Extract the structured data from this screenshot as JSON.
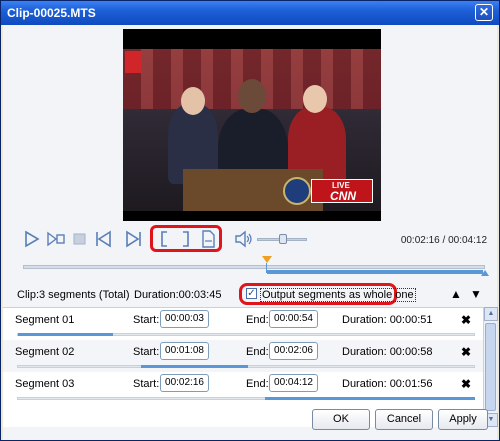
{
  "window": {
    "title": "Clip-00025.MTS"
  },
  "video": {
    "overlay_live": "LIVE",
    "overlay_network": "CNN"
  },
  "player": {
    "time_current": "00:02:16",
    "time_total": "00:04:12",
    "time_display": "00:02:16 / 00:04:12",
    "volume_level": 0.5
  },
  "summary": {
    "clip_info": "Clip:3 segments (Total)",
    "duration": "Duration:00:03:45",
    "output_label": "Output segments as whole one",
    "output_checked": true
  },
  "segments": [
    {
      "name": "Segment 01",
      "start_label": "Start:",
      "start": "00:00:03",
      "end_label": "End:",
      "end": "00:00:54",
      "duration": "Duration:  00:00:51"
    },
    {
      "name": "Segment 02",
      "start_label": "Start:",
      "start": "00:01:08",
      "end_label": "End:",
      "end": "00:02:06",
      "duration": "Duration:  00:00:58"
    },
    {
      "name": "Segment 03",
      "start_label": "Start:",
      "start": "00:02:16",
      "end_label": "End:",
      "end": "00:04:12",
      "duration": "Duration:  00:01:56"
    }
  ],
  "buttons": {
    "ok": "OK",
    "cancel": "Cancel",
    "apply": "Apply"
  },
  "icons": {
    "play": "play-icon",
    "step": "frame-step-icon",
    "stop": "stop-icon",
    "prev": "previous-icon",
    "next": "next-icon",
    "mark_in": "mark-in-bracket-icon",
    "mark_out": "mark-out-bracket-icon",
    "new_segment": "new-segment-icon",
    "volume": "volume-icon",
    "close": "close-icon",
    "move_up": "arrow-up-icon",
    "move_down": "arrow-down-icon",
    "delete": "delete-x-icon"
  },
  "colors": {
    "accent": "#5a97d6",
    "highlight": "#e0141b",
    "titlebar": "#1d5fd6"
  }
}
